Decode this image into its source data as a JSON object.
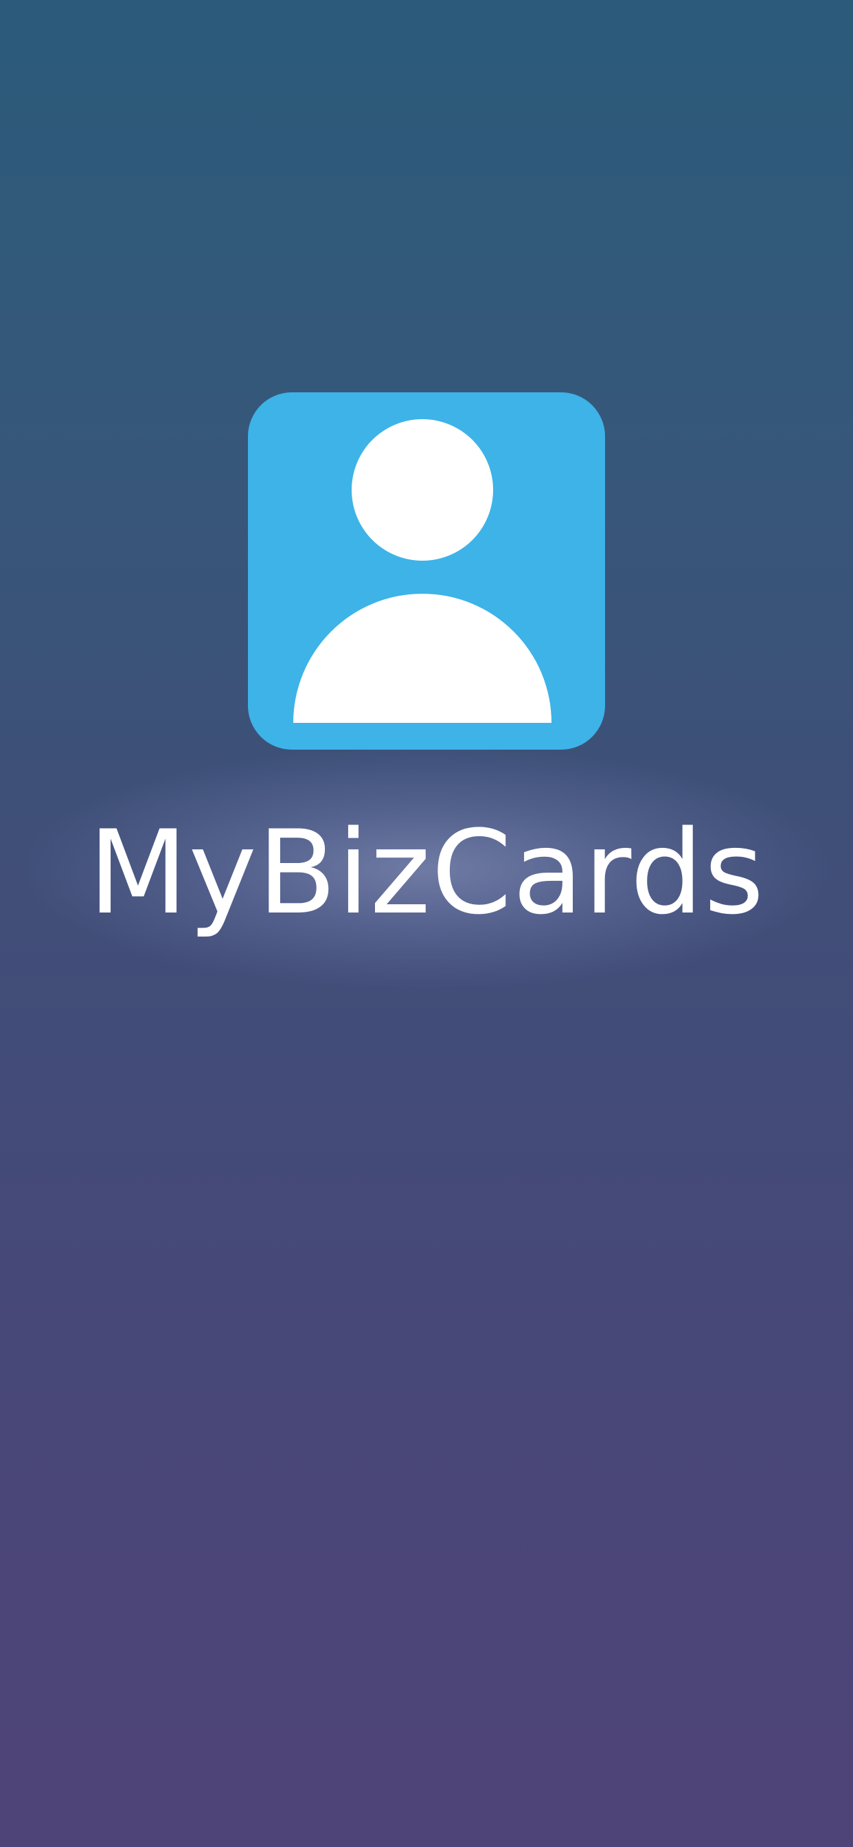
{
  "splash": {
    "app_name": "MyBizCards",
    "logo_icon": "person-contact-icon",
    "colors": {
      "background_top": "#2b5a7a",
      "background_bottom": "#4f4478",
      "logo_background": "#3db3e8",
      "logo_foreground": "#ffffff",
      "title_color": "#ffffff"
    }
  }
}
